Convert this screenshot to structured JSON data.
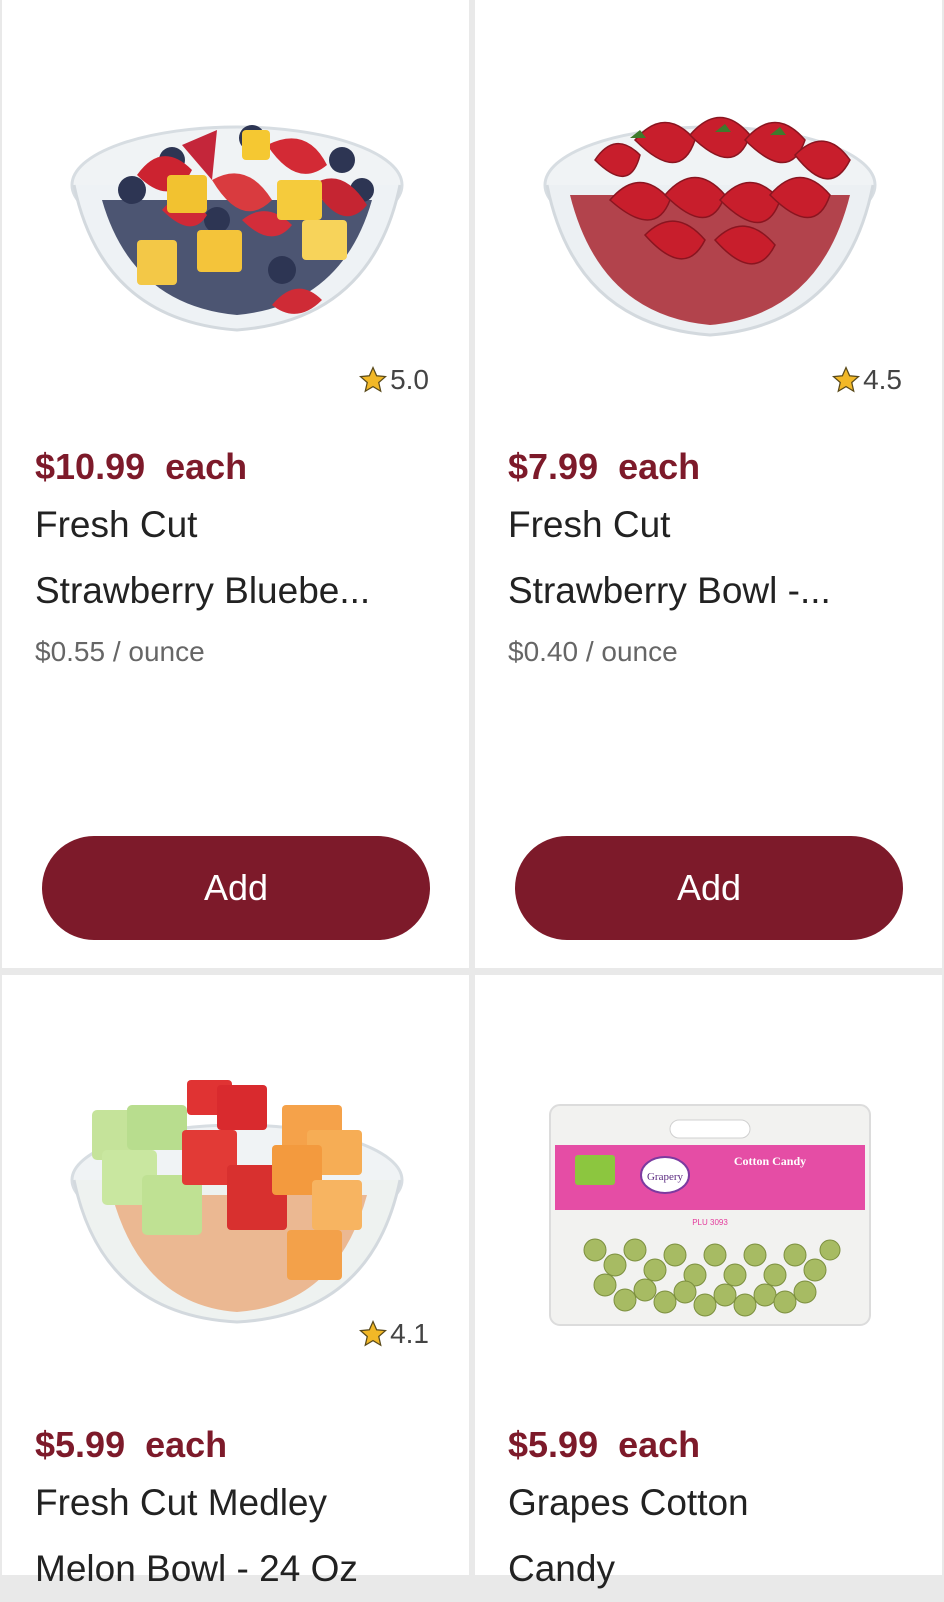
{
  "products": [
    {
      "rating": "5.0",
      "price": "$10.99",
      "price_unit": "each",
      "name_line1": "Fresh Cut",
      "name_line2": "Strawberry Bluebe...",
      "unit_price": "$0.55 / ounce",
      "add_label": "Add",
      "image": "fruit-bowl-strawberry-blueberry-pineapple"
    },
    {
      "rating": "4.5",
      "price": "$7.99",
      "price_unit": "each",
      "name_line1": "Fresh Cut",
      "name_line2": "Strawberry Bowl -...",
      "unit_price": "$0.40 / ounce",
      "add_label": "Add",
      "image": "strawberry-bowl"
    },
    {
      "rating": "4.1",
      "price": "$5.99",
      "price_unit": "each",
      "name_line1": "Fresh Cut Medley",
      "name_line2": "Melon Bowl - 24 Oz",
      "image": "melon-medley-bowl"
    },
    {
      "rating": "",
      "price": "$5.99",
      "price_unit": "each",
      "name_line1": "Grapes Cotton",
      "name_line2": "Candy",
      "image": "cotton-candy-grapes-bag",
      "package_brand": "Grapery",
      "package_title": "Cotton Candy",
      "package_code": "PLU 3093"
    }
  ],
  "colors": {
    "accent": "#7d1a2a",
    "star": "#f2b827",
    "background": "#e9e9e9",
    "card": "#ffffff"
  }
}
